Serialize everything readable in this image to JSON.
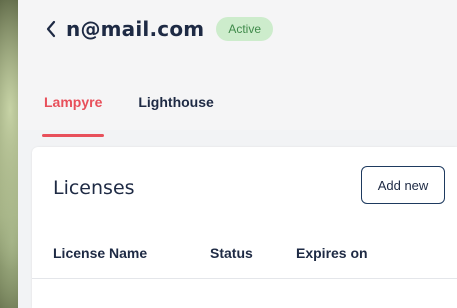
{
  "header": {
    "email": "n@mail.com",
    "status_badge": "Active"
  },
  "tabs": [
    {
      "label": "Lampyre",
      "active": true
    },
    {
      "label": "Lighthouse",
      "active": false
    }
  ],
  "licenses": {
    "title": "Licenses",
    "add_button": "Add new",
    "columns": [
      "License Name",
      "Status",
      "Expires on"
    ]
  },
  "colors": {
    "accent": "#e8505b",
    "text": "#1e2a44",
    "badge_bg": "#cdeccc",
    "badge_text": "#3f8a4a"
  },
  "icons": {
    "back": "chevron-left-icon"
  }
}
